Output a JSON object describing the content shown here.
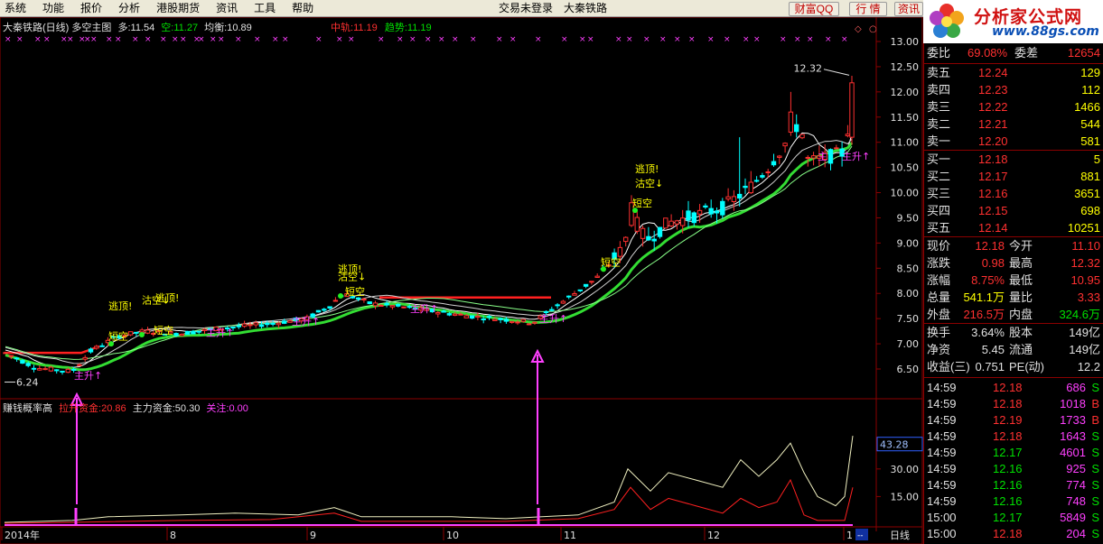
{
  "menu": {
    "items": [
      "系统",
      "功能",
      "报价",
      "分析",
      "港股期货",
      "资讯",
      "工具",
      "帮助"
    ],
    "status": "交易未登录",
    "stock_name": "大秦铁路",
    "buttons": {
      "caifu": "财富QQ",
      "hangqing": "行 情",
      "zixun": "资讯"
    }
  },
  "logo": {
    "title": "分析家公式网",
    "url": "www.88gs.com"
  },
  "main_info": {
    "title": "大秦铁路(日线) 多空主图",
    "duo_label": "多:",
    "duo_value": "11.54",
    "kong_label": "空:",
    "kong_value": "11.27",
    "junheng_label": "均衡:",
    "junheng_value": "10.89",
    "zhonggui_label": "中轨:",
    "zhonggui_value": "11.19",
    "qushi_label": "趋势:",
    "qushi_value": "11.19"
  },
  "sub_info": {
    "title": "赚钱概率高",
    "lasheng_label": "拉升资金:",
    "lasheng_value": "20.86",
    "zhuli_label": "主力资金:",
    "zhuli_value": "50.30",
    "guanzhu_label": "关注:",
    "guanzhu_value": "0.00"
  },
  "price_axis": {
    "ticks": [
      "13.00",
      "12.50",
      "12.00",
      "11.50",
      "11.00",
      "10.50",
      "10.00",
      "9.50",
      "9.00",
      "8.50",
      "8.00",
      "7.50",
      "7.00",
      "6.50"
    ]
  },
  "sub_axis": {
    "ticks": [
      "30.00",
      "15.00"
    ],
    "current": "43.28"
  },
  "time_axis": {
    "labels": [
      "2014年",
      "8",
      "9",
      "10",
      "11",
      "12",
      "1"
    ],
    "period": "日线"
  },
  "annotations": {
    "high_price": "12.32",
    "low_price": "6.24",
    "taoding": "逃顶!",
    "gukong": "沽空↓",
    "duankong": "短空",
    "zhusheng": "主升↑",
    "zhu": "主"
  },
  "quote": {
    "weibi_label": "委比",
    "weibi_value": "69.08%",
    "weicha_label": "委差",
    "weicha_value": "12654",
    "sells": [
      {
        "label": "卖五",
        "price": "12.24",
        "vol": "129"
      },
      {
        "label": "卖四",
        "price": "12.23",
        "vol": "112"
      },
      {
        "label": "卖三",
        "price": "12.22",
        "vol": "1466"
      },
      {
        "label": "卖二",
        "price": "12.21",
        "vol": "544"
      },
      {
        "label": "卖一",
        "price": "12.20",
        "vol": "581"
      }
    ],
    "buys": [
      {
        "label": "买一",
        "price": "12.18",
        "vol": "5"
      },
      {
        "label": "买二",
        "price": "12.17",
        "vol": "881"
      },
      {
        "label": "买三",
        "price": "12.16",
        "vol": "3651"
      },
      {
        "label": "买四",
        "price": "12.15",
        "vol": "698"
      },
      {
        "label": "买五",
        "price": "12.14",
        "vol": "10251"
      }
    ],
    "stats": [
      {
        "l1": "现价",
        "v1": "12.18",
        "l2": "今开",
        "v2": "11.10",
        "c1": "red",
        "c2": "red"
      },
      {
        "l1": "涨跌",
        "v1": "0.98",
        "l2": "最高",
        "v2": "12.32",
        "c1": "red",
        "c2": "red"
      },
      {
        "l1": "涨幅",
        "v1": "8.75%",
        "l2": "最低",
        "v2": "10.95",
        "c1": "red",
        "c2": "red"
      },
      {
        "l1": "总量",
        "v1": "541.1万",
        "l2": "量比",
        "v2": "3.33",
        "c1": "yellow",
        "c2": "red"
      },
      {
        "l1": "外盘",
        "v1": "216.5万",
        "l2": "内盘",
        "v2": "324.6万",
        "c1": "red",
        "c2": "green"
      }
    ],
    "fund": [
      {
        "l1": "换手",
        "v1": "3.64%",
        "l2": "股本",
        "v2": "149亿"
      },
      {
        "l1": "净资",
        "v1": "5.45",
        "l2": "流通",
        "v2": "149亿"
      },
      {
        "l1": "收益(三)",
        "v1": "0.751",
        "l2": "PE(动)",
        "v2": "12.2"
      }
    ],
    "ticks": [
      {
        "time": "14:59",
        "price": "12.18",
        "vol": "686",
        "side": "S"
      },
      {
        "time": "14:59",
        "price": "12.18",
        "vol": "1018",
        "side": "B"
      },
      {
        "time": "14:59",
        "price": "12.19",
        "vol": "1733",
        "side": "B"
      },
      {
        "time": "14:59",
        "price": "12.18",
        "vol": "1643",
        "side": "S"
      },
      {
        "time": "14:59",
        "price": "12.17",
        "vol": "4601",
        "side": "S"
      },
      {
        "time": "14:59",
        "price": "12.16",
        "vol": "925",
        "side": "S"
      },
      {
        "time": "14:59",
        "price": "12.16",
        "vol": "774",
        "side": "S"
      },
      {
        "time": "14:59",
        "price": "12.16",
        "vol": "748",
        "side": "S"
      },
      {
        "time": "15:00",
        "price": "12.17",
        "vol": "5849",
        "side": "S"
      },
      {
        "time": "15:00",
        "price": "12.18",
        "vol": "204",
        "side": "S"
      }
    ]
  },
  "colors": {
    "up": "#ff3030",
    "down": "#00ffff",
    "line_green": "#33dd33",
    "signal": "#ff40ff"
  }
}
